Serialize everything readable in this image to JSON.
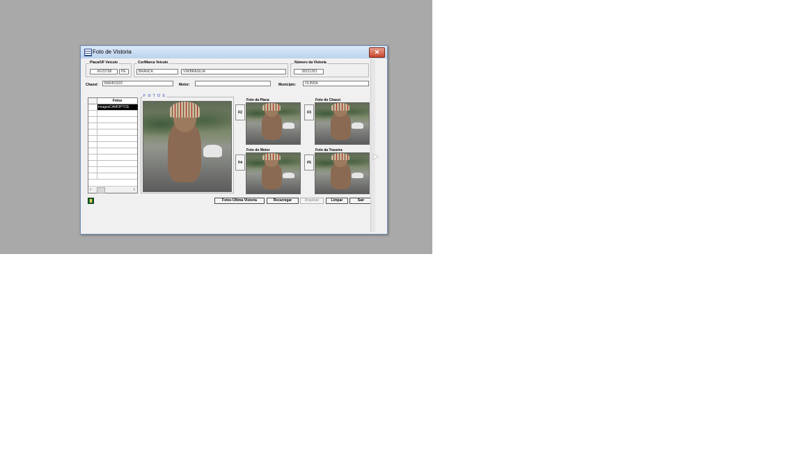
{
  "window": {
    "title": "Foto de Vistoria",
    "close_glyph": "✕"
  },
  "header": {
    "placa_uf": {
      "legend": "Placa/UF Veículo",
      "placa": "KFZ0798",
      "uf": "PE"
    },
    "cor_marca": {
      "legend": "Cor/Marca Veículo",
      "cor": "BRANCA",
      "marca": "VW/BRASILIA"
    },
    "numero_vistoria": {
      "legend": "Número da Vistoria",
      "value": "28221281"
    }
  },
  "fields": {
    "chassi": {
      "label": "Chassi:",
      "value": "BA6453332"
    },
    "motor": {
      "label": "Motor:",
      "value": ""
    },
    "municipio": {
      "label": "Município:",
      "value": "OLINDA"
    }
  },
  "fotos_list": {
    "column_header": "Fotos",
    "rows": [
      "imagesCAMOPTCE",
      "",
      "",
      "",
      "",
      "",
      "",
      "",
      "",
      "",
      "",
      ""
    ],
    "selected_index": 0
  },
  "fotos_frame": {
    "legend": "F O T O S"
  },
  "photos": {
    "placa": {
      "title": "Foto da Placa",
      "key": "F2"
    },
    "chassi": {
      "title": "Foto do Chassi",
      "key": "F3"
    },
    "motor": {
      "title": "Foto do Motor",
      "key": "F4"
    },
    "traseira": {
      "title": "Foto da Traseira",
      "key": "F5"
    }
  },
  "buttons": {
    "fotos_ultima": "Fotos Última Vistoria",
    "recarregar": "Recarregar",
    "arquivar": "Arquivar",
    "limpar": "Limpar",
    "sair": "Sair"
  },
  "icons": {
    "window": "form-icon",
    "close": "close-icon",
    "status": "traffic-light-icon",
    "scroll_left": "chevron-left-icon",
    "scroll_right": "chevron-right-icon"
  },
  "colors": {
    "desktop": "#a9a9a9",
    "window_bg": "#f0f0f0",
    "close_button": "#c6442c",
    "selection": "#000000",
    "fotos_legend": "#1a2fb5"
  }
}
